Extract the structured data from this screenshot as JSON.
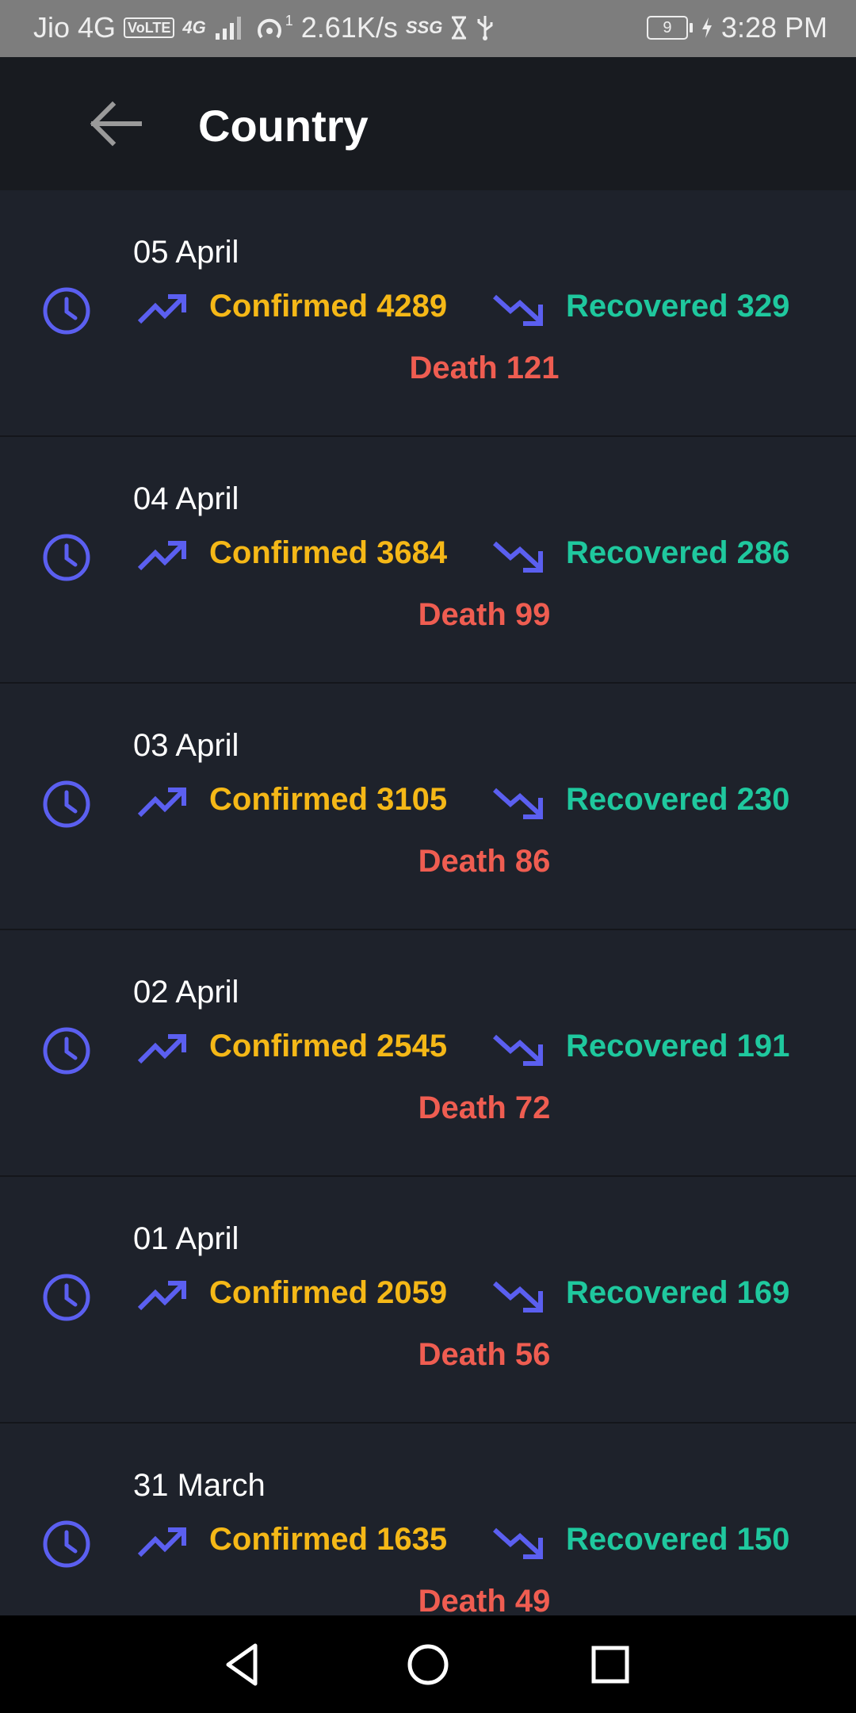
{
  "status_bar": {
    "carrier": "Jio 4G",
    "volte": "VoLTE",
    "net_gen": "4G",
    "hotspot_count": "1",
    "speed": "2.61K/s",
    "ssg": "SSG",
    "battery": "9",
    "time": "3:28 PM"
  },
  "header": {
    "title": "Country"
  },
  "colors": {
    "confirmed": "#f5b817",
    "recovered": "#1fc89e",
    "death": "#ef5d51",
    "icon_accent": "#5b5ff0"
  },
  "records": [
    {
      "date": "05 April",
      "confirmed": "Confirmed 4289",
      "recovered": "Recovered 329",
      "death": "Death 121"
    },
    {
      "date": "04 April",
      "confirmed": "Confirmed 3684",
      "recovered": "Recovered 286",
      "death": "Death 99"
    },
    {
      "date": "03 April",
      "confirmed": "Confirmed 3105",
      "recovered": "Recovered 230",
      "death": "Death 86"
    },
    {
      "date": "02 April",
      "confirmed": "Confirmed 2545",
      "recovered": "Recovered 191",
      "death": "Death 72"
    },
    {
      "date": "01 April",
      "confirmed": "Confirmed 2059",
      "recovered": "Recovered 169",
      "death": "Death 56"
    },
    {
      "date": "31 March",
      "confirmed": "Confirmed 1635",
      "recovered": "Recovered 150",
      "death": "Death 49"
    }
  ],
  "nav": {
    "icons": [
      "back-triangle-icon",
      "home-circle-icon",
      "recents-square-icon"
    ]
  }
}
